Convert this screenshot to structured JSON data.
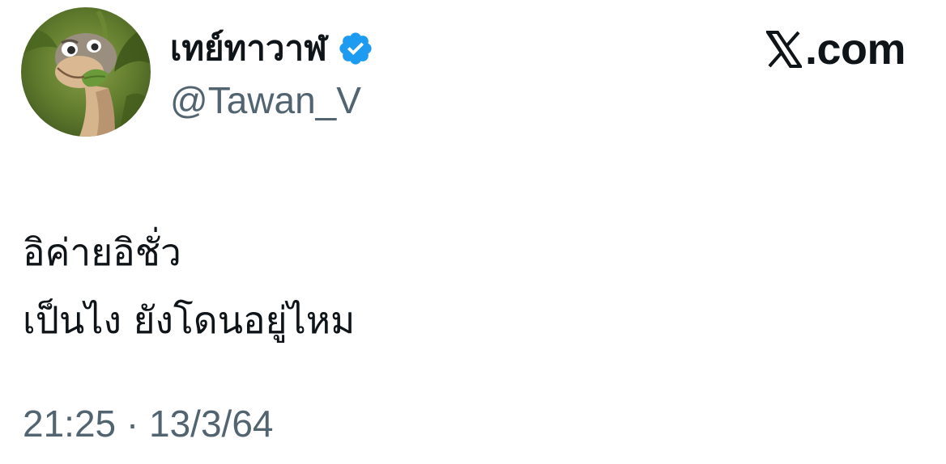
{
  "author": {
    "display_name": "เทย์ทาวาฬ",
    "handle": "@Tawan_V",
    "verified": true,
    "avatar_icon": "cartoon-dinosaur-avatar"
  },
  "site": {
    "logo_icon": "x-logo-icon",
    "domain": "X.com",
    "domain_suffix": ".com"
  },
  "tweet": {
    "lines": [
      "อิค่ายอิชั่ว",
      "เป็นไง ยังโดนอยู่ไหม"
    ]
  },
  "meta": {
    "time": "21:25",
    "separator": " · ",
    "date": "13/3/64"
  },
  "colors": {
    "text_primary": "#0f1419",
    "text_secondary": "#536471",
    "verified_blue": "#1d9bf0",
    "background": "#ffffff"
  }
}
